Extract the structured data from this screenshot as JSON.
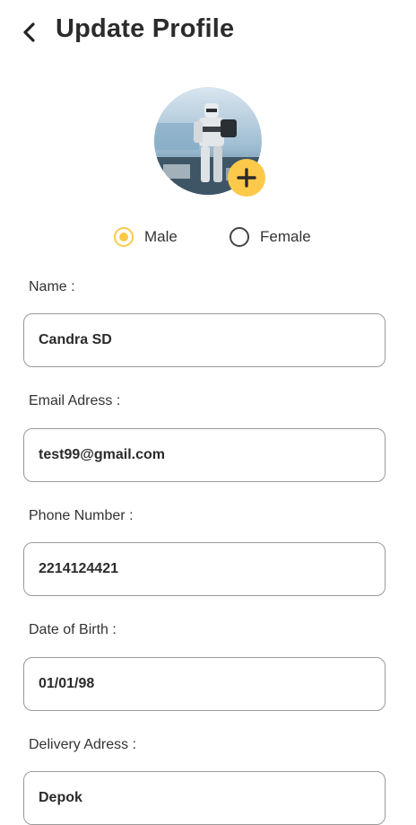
{
  "header": {
    "title": "Update Profile",
    "back_icon": "chevron-left-icon"
  },
  "avatar": {
    "add_icon": "plus-icon",
    "accent_color": "#fcc94a"
  },
  "gender": {
    "options": [
      {
        "label": "Male",
        "selected": true
      },
      {
        "label": "Female",
        "selected": false
      }
    ]
  },
  "form": {
    "name": {
      "label": "Name :",
      "value": "Candra SD"
    },
    "email": {
      "label": "Email Adress :",
      "value": "test99@gmail.com"
    },
    "phone": {
      "label": "Phone Number :",
      "value": "2214124421"
    },
    "dob": {
      "label": "Date of Birth :",
      "value": "01/01/98"
    },
    "address": {
      "label": "Delivery Adress :",
      "value": "Depok"
    }
  }
}
